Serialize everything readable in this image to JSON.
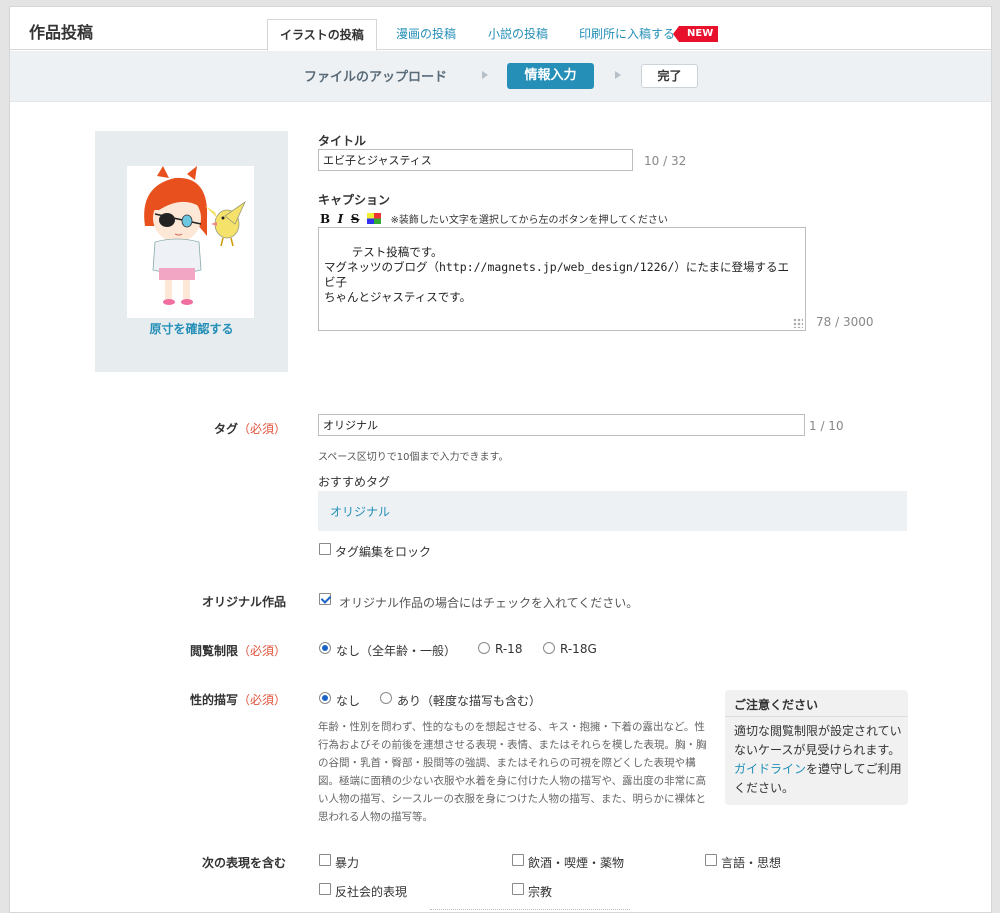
{
  "header": {
    "title": "作品投稿",
    "tabs": [
      "イラストの投稿",
      "漫画の投稿",
      "小説の投稿",
      "印刷所に入稿する"
    ],
    "badge": "NEW"
  },
  "steps": {
    "step1": "ファイルのアップロード",
    "step2": "情報入力",
    "step3": "完了"
  },
  "thumbnail": {
    "link_label": "原寸を確認する"
  },
  "title_field": {
    "label": "タイトル",
    "value": "エビ子とジャスティス",
    "counter": "10 / 32"
  },
  "caption_field": {
    "label": "キャプション",
    "toolbar_hint": "※装飾したい文字を選択してから左のボタンを押してください",
    "value": "テスト投稿です。\nマグネッツのブログ（http://magnets.jp/web_design/1226/）にたまに登場するエビ子\nちゃんとジャスティスです。",
    "counter": "78 / 3000"
  },
  "tag_field": {
    "label": "タグ",
    "required": "（必須）",
    "value": "オリジナル",
    "counter": "1 / 10",
    "help": "スペース区切りで10個まで入力できます。",
    "recommended_label": "おすすめタグ",
    "recommended_tag": "オリジナル",
    "lock_label": "タグ編集をロック"
  },
  "original": {
    "label": "オリジナル作品",
    "checkbox_label": "オリジナル作品の場合にはチェックを入れてください。"
  },
  "rating": {
    "label": "閲覧制限",
    "required": "（必須）",
    "options": [
      "なし（全年齢・一般）",
      "R-18",
      "R-18G"
    ]
  },
  "sexual": {
    "label": "性的描写",
    "required": "（必須）",
    "options": [
      "なし",
      "あり（軽度な描写も含む）"
    ],
    "notice": "年齢・性別を問わず、性的なものを想起させる、キス・抱擁・下着の露出など。性行為およびその前後を連想させる表現・表情、またはそれらを模した表現。胸・胸の谷間・乳首・臀部・股間等の強調、またはそれらの可視を際どくした表現や構図。極端に面積の少ない衣服や水着を身に付けた人物の描写や、露出度の非常に高い人物の描写、シースルーの衣服を身につけた人物の描写、また、明らかに裸体と思われる人物の描写等。"
  },
  "caution": {
    "title": "ご注意ください",
    "body_before": "適切な閲覧制限が設定されていないケースが見受けられます。",
    "link": "ガイドライン",
    "body_after": "を遵守してご利用ください。"
  },
  "expressions": {
    "label": "次の表現を含む",
    "options": [
      "暴力",
      "飲酒・喫煙・薬物",
      "言語・思想",
      "反社会的表現",
      "宗教"
    ]
  },
  "colors": {
    "accent": "#258fb8",
    "required": "#e0543d",
    "badge": "#e8102b"
  }
}
